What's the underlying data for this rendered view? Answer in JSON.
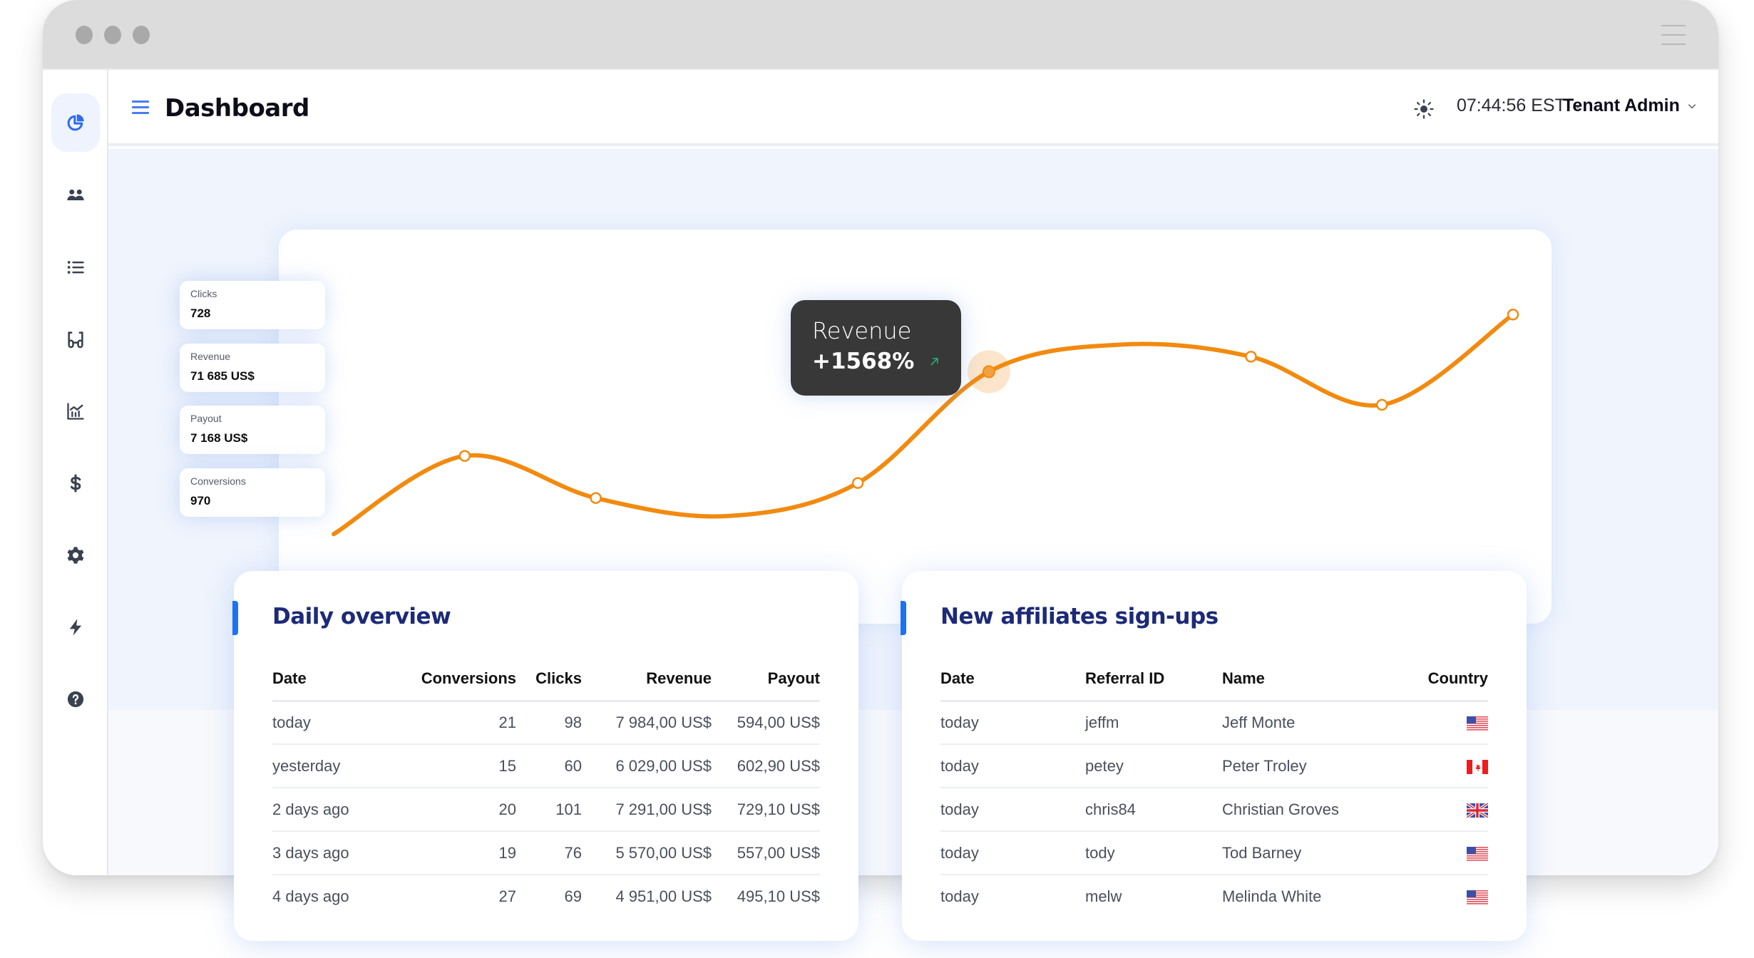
{
  "window": {
    "titlebar_menu_icon": "hamburger-icon"
  },
  "sidebar": {
    "items": [
      {
        "id": "dashboard",
        "icon": "pie-chart-icon",
        "active": true
      },
      {
        "id": "affiliates",
        "icon": "users-icon",
        "active": false
      },
      {
        "id": "list",
        "icon": "list-icon",
        "active": false
      },
      {
        "id": "creatives",
        "icon": "glasses-icon",
        "active": false
      },
      {
        "id": "reports",
        "icon": "chart-icon",
        "active": false
      },
      {
        "id": "payouts",
        "icon": "dollar-icon",
        "active": false
      },
      {
        "id": "settings",
        "icon": "gear-icon",
        "active": false
      },
      {
        "id": "integrations",
        "icon": "lightning-icon",
        "active": false
      },
      {
        "id": "help",
        "icon": "help-icon",
        "active": false
      }
    ]
  },
  "header": {
    "title": "Dashboard",
    "clock": "07:44:56 EST",
    "user": "Tenant Admin"
  },
  "stats": [
    {
      "label": "Clicks",
      "value": "728"
    },
    {
      "label": "Revenue",
      "value": "71 685 US$"
    },
    {
      "label": "Payout",
      "value": "7 168 US$"
    },
    {
      "label": "Conversions",
      "value": "970"
    }
  ],
  "tooltip": {
    "label": "Revenue",
    "value": "+1568%",
    "trend": "up"
  },
  "colors": {
    "accent": "#1a73f5",
    "line": "#f28a0f",
    "title": "#1c2a78",
    "trend_up": "#1fb873"
  },
  "chart_data": {
    "type": "line",
    "title": "",
    "xlabel": "",
    "ylabel": "",
    "grid": false,
    "legend": "none",
    "ylim": [
      0,
      100
    ],
    "series": [
      {
        "name": "Revenue",
        "values": [
          12,
          38,
          24,
          18,
          29,
          66,
          75,
          71,
          55,
          85
        ],
        "markers": [
          false,
          true,
          true,
          false,
          true,
          true,
          false,
          true,
          true,
          true
        ],
        "highlighted_index": 5
      }
    ]
  },
  "daily_overview": {
    "title": "Daily overview",
    "columns": [
      "Date",
      "Conversions",
      "Clicks",
      "Revenue",
      "Payout"
    ],
    "rows": [
      [
        "today",
        "21",
        "98",
        "7 984,00 US$",
        "594,00 US$"
      ],
      [
        "yesterday",
        "15",
        "60",
        "6 029,00 US$",
        "602,90 US$"
      ],
      [
        "2 days ago",
        "20",
        "101",
        "7 291,00 US$",
        "729,10 US$"
      ],
      [
        "3 days ago",
        "19",
        "76",
        "5 570,00 US$",
        "557,00 US$"
      ],
      [
        "4 days ago",
        "27",
        "69",
        "4 951,00 US$",
        "495,10 US$"
      ]
    ]
  },
  "affiliates": {
    "title": "New affiliates sign-ups",
    "columns": [
      "Date",
      "Referral ID",
      "Name",
      "Country"
    ],
    "rows": [
      [
        "today",
        "jeffm",
        "Jeff Monte",
        "us"
      ],
      [
        "today",
        "petey",
        "Peter Troley",
        "ca"
      ],
      [
        "today",
        "chris84",
        "Christian Groves",
        "gb"
      ],
      [
        "today",
        "tody",
        "Tod Barney",
        "us"
      ],
      [
        "today",
        "melw",
        "Melinda White",
        "us"
      ]
    ]
  }
}
